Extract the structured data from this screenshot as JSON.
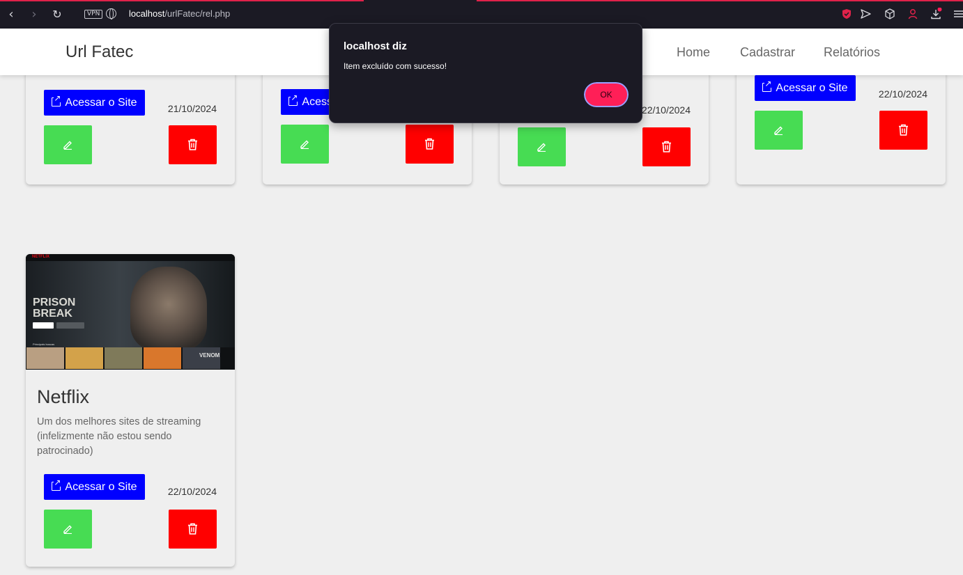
{
  "browser": {
    "url_host": "localhost",
    "url_path": "/urlFatec/rel.php",
    "vpn_label": "VPN",
    "accent_color": "#e0224a"
  },
  "navbar": {
    "brand": "Url Fatec",
    "links": [
      "Home",
      "Cadastrar",
      "Relatórios"
    ]
  },
  "cards": [
    {
      "site_button": "Acessar o Site",
      "date": "21/10/2024"
    },
    {
      "site_button": "Acessar o Site",
      "date": ""
    },
    {
      "site_button": "",
      "date": "22/10/2024"
    },
    {
      "site_button": "Acessar o Site",
      "date": "22/10/2024"
    },
    {
      "title": "Netflix",
      "description": "Um dos melhores sites de streaming (infelizmente não estou sendo patrocinado)",
      "site_button": "Acessar o Site",
      "date": "22/10/2024",
      "thumbnail": {
        "logo": "NETFLIX",
        "show_title_line1": "PRISON",
        "show_title_line2": "BREAK",
        "row_label": "Principais buscas",
        "tile_label": "VENOM"
      }
    }
  ],
  "dialog": {
    "title": "localhost diz",
    "message": "Item excluído com sucesso!",
    "ok_label": "OK"
  },
  "icons": {
    "edit": "pencil-icon",
    "delete": "trash-icon",
    "external": "external-link-icon"
  },
  "colors": {
    "site_button": "#0000ff",
    "edit_button": "#47dc53",
    "delete_button": "#ff0000",
    "dialog_ok": "#ff1f57"
  }
}
